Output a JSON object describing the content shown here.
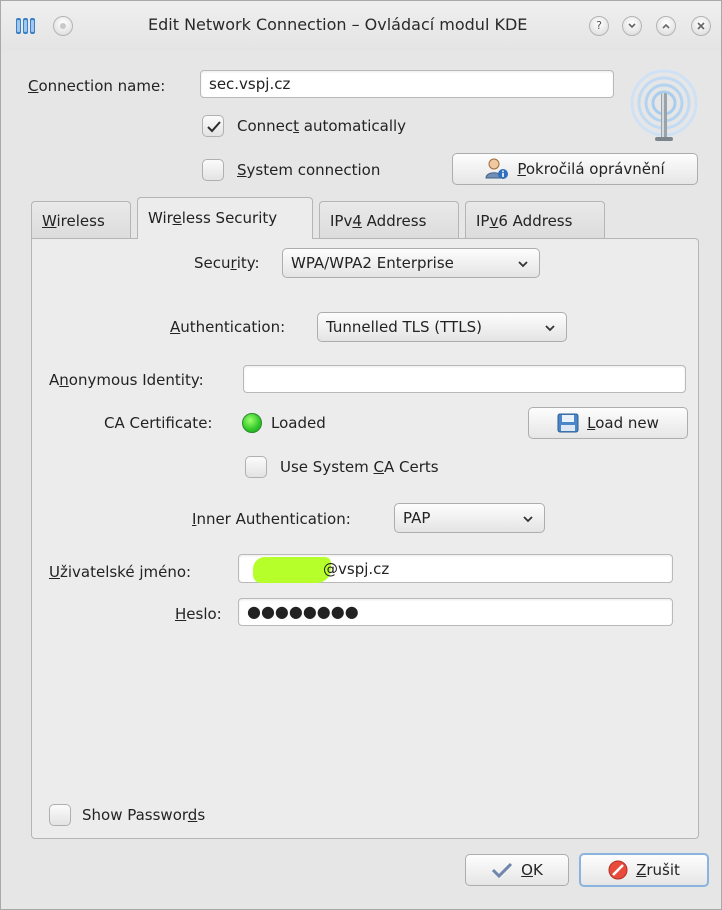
{
  "window": {
    "title": "Edit Network Connection – Ovládací modul KDE",
    "help_glyph": "?",
    "minimize_glyph": "⌄",
    "maximize_glyph": "⌃",
    "close_glyph": "✕"
  },
  "connection": {
    "name_label": "Connection name:",
    "name_label_u": "C",
    "name_label_rest": "onnection name:",
    "name_value": "sec.vspj.cz",
    "connect_auto_pre": "Connec",
    "connect_auto_u": "t",
    "connect_auto_post": " automatically",
    "connect_auto_checked": true,
    "system_conn_u": "S",
    "system_conn_post": "ystem connection",
    "system_conn_checked": false,
    "advanced_perms_u": "P",
    "advanced_perms_post": "okročilá oprávnění"
  },
  "tabs": [
    {
      "label_u": "W",
      "label_post": "ireless",
      "active": false
    },
    {
      "label_pre": "Wir",
      "label_u": "e",
      "label_post": "less Security",
      "active": true
    },
    {
      "label_pre": "IPv",
      "label_u": "4",
      "label_post": " Address",
      "active": false
    },
    {
      "label_pre": "IP",
      "label_u": "v",
      "label_post": "6 Address",
      "active": false
    }
  ],
  "security": {
    "security_label_pre": "Secu",
    "security_label_u": "r",
    "security_label_post": "ity:",
    "security_value": "WPA/WPA2 Enterprise",
    "auth_label_u": "A",
    "auth_label_post": "uthentication:",
    "auth_value": "Tunnelled TLS (TTLS)",
    "anon_label_pre": "A",
    "anon_label_u": "n",
    "anon_label_post": "onymous Identity:",
    "anon_value": "",
    "ca_label": "CA Certificate:",
    "ca_status": "Loaded",
    "ca_status_color": "#2fc72a",
    "load_new_u": "L",
    "load_new_post": "oad new",
    "use_system_ca_pre": "Use System ",
    "use_system_ca_u": "C",
    "use_system_ca_post": "A Certs",
    "use_system_ca_checked": false,
    "inner_auth_u": "I",
    "inner_auth_post": "nner Authentication:",
    "inner_auth_value": "PAP",
    "username_label_u": "U",
    "username_label_post": "živatelské jméno:",
    "username_value": "@vspj.cz",
    "password_label_u": "H",
    "password_label_post": "eslo:",
    "password_value": "●●●●●●●●",
    "show_passwords_pre": "Show Passwor",
    "show_passwords_u": "d",
    "show_passwords_post": "s",
    "show_passwords_checked": false
  },
  "footer": {
    "ok_u": "O",
    "ok_post": "K",
    "cancel_u": "Z",
    "cancel_post": "rušit"
  }
}
